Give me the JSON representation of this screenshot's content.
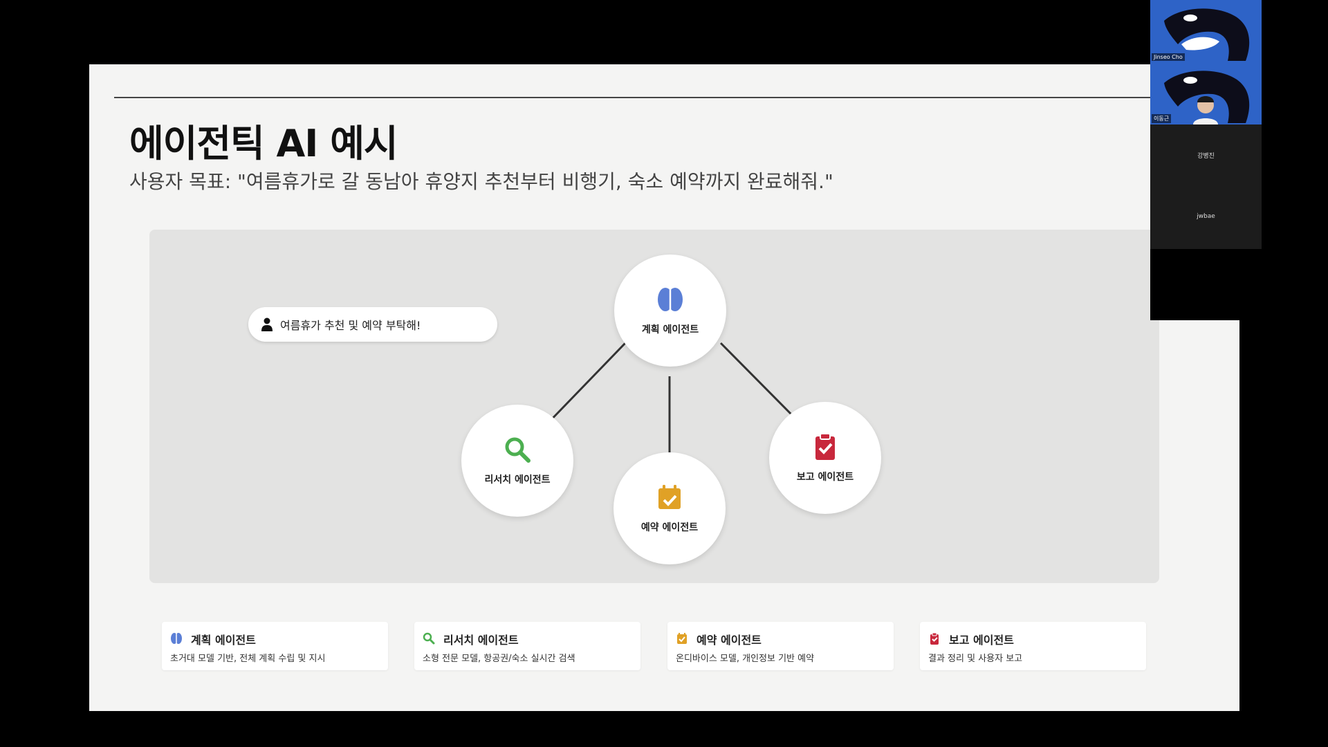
{
  "slide": {
    "title": "에이전틱 AI 예시",
    "subtitle": "사용자 목표: \"여름휴가로 갈 동남아 휴양지 추천부터 비행기, 숙소 예약까지 완료해줘.\"",
    "user_request": "여름휴가 추천 및 예약 부탁해!",
    "nodes": {
      "planning": "계획 에이전트",
      "research": "리서치 에이전트",
      "booking": "예약 에이전트",
      "report": "보고 에이전트"
    },
    "cards": [
      {
        "title": "계획 에이전트",
        "desc": "초거대 모델 기반, 전체 계획 수립 및 지시",
        "icon": "brain-icon",
        "color": "#5b7fd6"
      },
      {
        "title": "리서치 에이전트",
        "desc": "소형 전문 모델, 항공권/숙소 실시간 검색",
        "icon": "search-icon",
        "color": "#4caf50"
      },
      {
        "title": "예약 에이전트",
        "desc": "온디바이스 모델, 개인정보 기반 예약",
        "icon": "calendar-check-icon",
        "color": "#e0a126"
      },
      {
        "title": "보고 에이전트",
        "desc": "결과 정리 및 사용자 보고",
        "icon": "clipboard-check-icon",
        "color": "#c8283c"
      }
    ]
  },
  "participants": [
    {
      "name": "Jinseo Cho"
    },
    {
      "name": "이동근"
    },
    {
      "name": "강병진"
    },
    {
      "name": "jwbae"
    }
  ]
}
